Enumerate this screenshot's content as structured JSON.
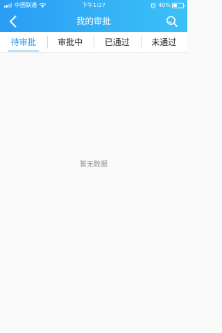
{
  "status_bar": {
    "carrier": "中国联通",
    "time": "下午1:27",
    "battery": "40%",
    "battery_level": 0.4
  },
  "header": {
    "title": "我的审批",
    "back_icon": "chevron-left-icon",
    "search_icon": "search-icon"
  },
  "tabs": [
    {
      "label": "待审批",
      "active": true
    },
    {
      "label": "审批中",
      "active": false
    },
    {
      "label": "已通过",
      "active": false
    },
    {
      "label": "未通过",
      "active": false
    }
  ],
  "empty_state": {
    "text": "暂无数据"
  },
  "colors": {
    "header_start": "#2a9cf3",
    "header_end": "#3cc0f8",
    "accent": "#1f97f0",
    "background": "#fafafa"
  }
}
